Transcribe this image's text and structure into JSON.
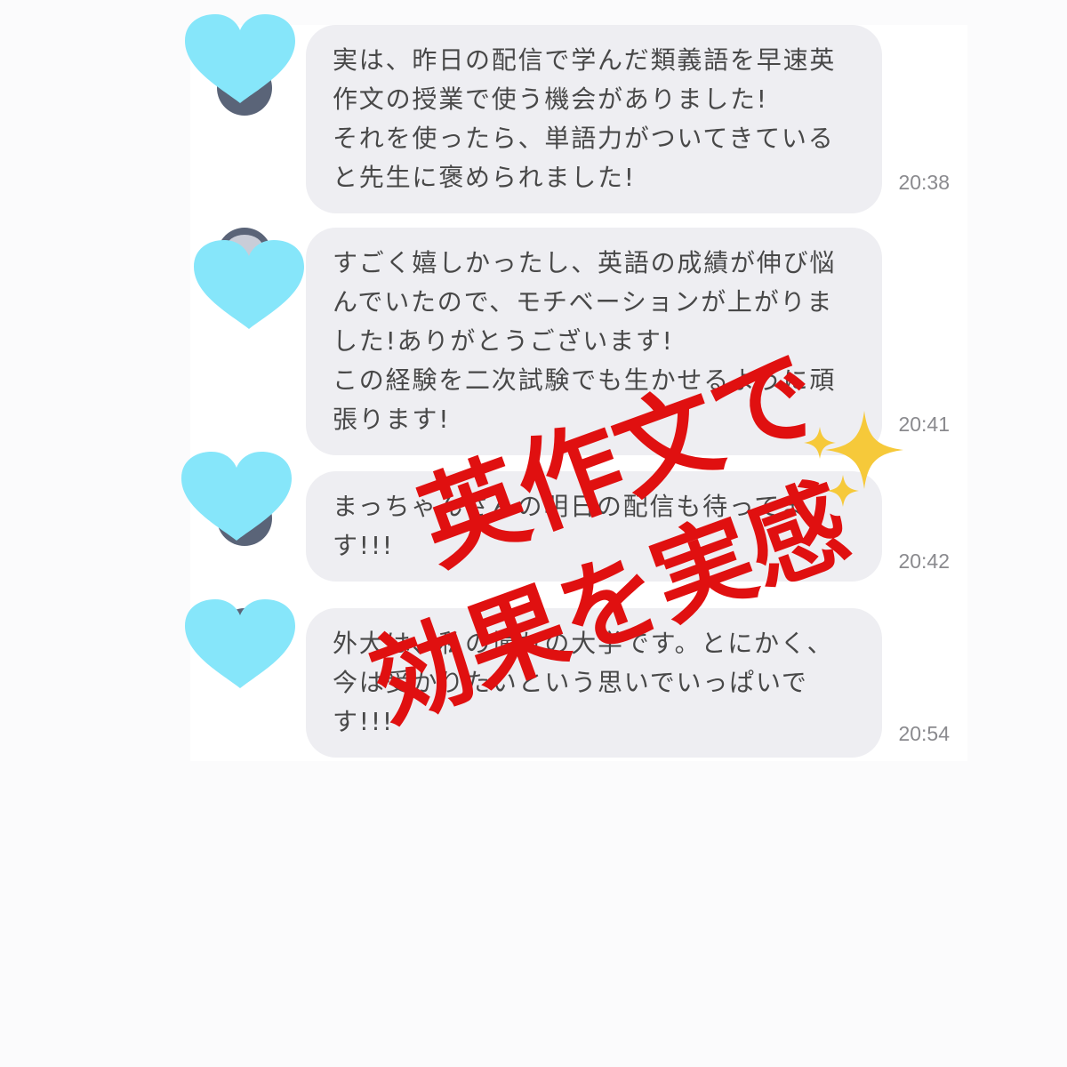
{
  "messages": [
    {
      "lines": [
        "実は、昨日の配信で学んだ類義語を早速英",
        "作文の授業で使う機会がありました!",
        "それを使ったら、単語力がついてきている",
        "と先生に褒められました!"
      ],
      "time": "20:38"
    },
    {
      "lines": [
        "すごく嬉しかったし、英語の成績が伸び悩",
        "んでいたので、モチベーションが上がりま",
        "した!ありがとうございます!",
        "この経験を二次試験でも生かせるように頑",
        "張ります!"
      ],
      "time": "20:41"
    },
    {
      "lines": [
        "まっちゃんさんの明日の配信も待ってま",
        "す!!!"
      ],
      "time": "20:42"
    },
    {
      "lines": [
        "外大は、私の憧れの大学です。とにかく、",
        "今は受かりたいという思いでいっぱいで",
        "す!!!"
      ],
      "time": "20:54"
    }
  ],
  "overlay": {
    "line1": "英作文で",
    "line2": "効果を実感",
    "color": "#e01010",
    "sparkle_color": "#f6c93a"
  },
  "heart_color": "#86e6fa"
}
